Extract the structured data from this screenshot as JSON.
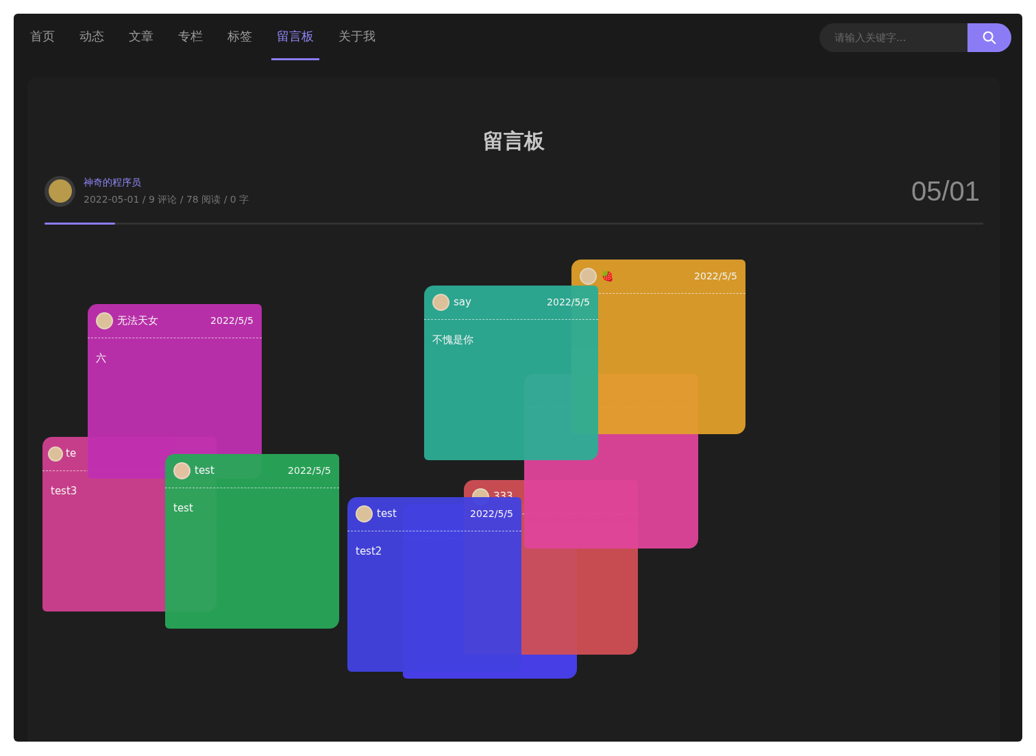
{
  "nav": {
    "tabs": [
      {
        "label": "首页",
        "selected": false
      },
      {
        "label": "动态",
        "selected": false
      },
      {
        "label": "文章",
        "selected": false
      },
      {
        "label": "专栏",
        "selected": false
      },
      {
        "label": "标签",
        "selected": false
      },
      {
        "label": "留言板",
        "selected": true
      },
      {
        "label": "关于我",
        "selected": false
      }
    ],
    "search": {
      "placeholder": "请输入关键字..."
    }
  },
  "post": {
    "title": "留言板",
    "author": "神奇的程序员",
    "meta": "2022-05-01 / 9 评论 / 78 阅读 / 0 字",
    "date": "05/01",
    "progress": {
      "level": 0.075
    }
  },
  "notes": [
    {
      "color": "#d0408f",
      "name": "te",
      "content": "test3"
    },
    {
      "color": "#c030b0",
      "name": "无法天女",
      "date": "2022/5/5",
      "content": "六"
    },
    {
      "color": "#28a858",
      "name": "test",
      "date": "2022/5/5",
      "content": "test"
    },
    {
      "color": "#4a40f0"
    },
    {
      "color": "#d04f55",
      "name": "333"
    },
    {
      "color": "#e0449a"
    },
    {
      "color": "#e09f2a",
      "name": "🍓",
      "date": "2022/5/5"
    },
    {
      "color": "#2cad95",
      "name": "say",
      "date": "2022/5/5",
      "content": "不愧是你"
    },
    {
      "color": "#4242e0",
      "name": "test",
      "date": "2022/5/5",
      "content": "test2"
    }
  ]
}
